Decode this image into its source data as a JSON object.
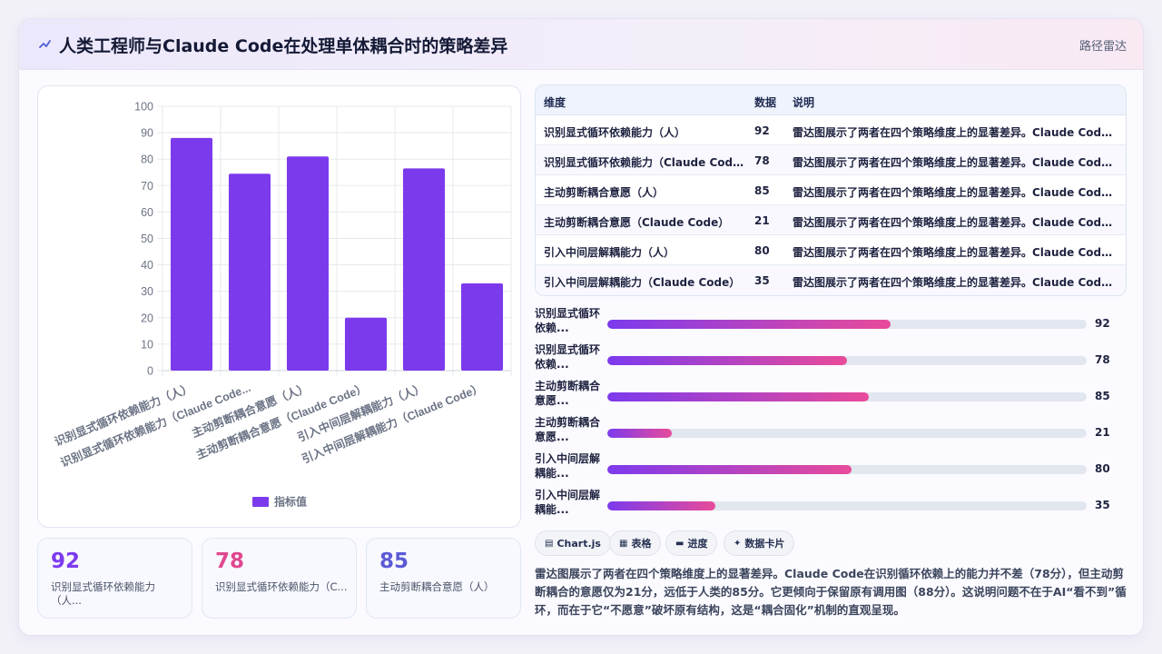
{
  "header": {
    "logo_icon": "wave-icon",
    "title": "人类工程师与Claude Code在处理单体耦合时的策略差异",
    "right_link": "路径雷达"
  },
  "chart_data": {
    "type": "bar",
    "categories": [
      "识别显式循环依赖能力（人）",
      "识别显式循环依赖能力（Claude Code...",
      "主动剪断耦合意愿（人）",
      "主动剪断耦合意愿（Claude Code）",
      "引入中间层解耦能力（人）",
      "引入中间层解耦能力（Claude Code）"
    ],
    "series": [
      {
        "name": "指标值",
        "values": [
          88,
          74.5,
          81,
          20,
          76.5,
          33
        ]
      }
    ],
    "ylim": [
      0,
      100
    ],
    "yticks": [
      0,
      10,
      20,
      30,
      40,
      50,
      60,
      70,
      80,
      90,
      100
    ],
    "grid": true,
    "legend": "bottom",
    "bar_color": "#7c3aed"
  },
  "stats": [
    {
      "value": "92",
      "label": "识别显式循环依赖能力（人...",
      "color": "#7c3aed"
    },
    {
      "value": "78",
      "label": "识别显式循环依赖能力（C...",
      "color": "#e0488f"
    },
    {
      "value": "85",
      "label": "主动剪断耦合意愿（人）",
      "color": "#5b5bd6"
    }
  ],
  "table": {
    "headers": [
      "维度",
      "数据",
      "说明"
    ],
    "rows": [
      {
        "dim": "识别显式循环依赖能力（人）",
        "val": "92",
        "desc": "雷达图展示了两者在四个策略维度上的显著差异。Claude Code在..."
      },
      {
        "dim": "识别显式循环依赖能力（Claude Code...",
        "val": "78",
        "desc": "雷达图展示了两者在四个策略维度上的显著差异。Claude Code在..."
      },
      {
        "dim": "主动剪断耦合意愿（人）",
        "val": "85",
        "desc": "雷达图展示了两者在四个策略维度上的显著差异。Claude Code在..."
      },
      {
        "dim": "主动剪断耦合意愿（Claude Code）",
        "val": "21",
        "desc": "雷达图展示了两者在四个策略维度上的显著差异。Claude Code在..."
      },
      {
        "dim": "引入中间层解耦能力（人）",
        "val": "80",
        "desc": "雷达图展示了两者在四个策略维度上的显著差异。Claude Code在..."
      },
      {
        "dim": "引入中间层解耦能力（Claude Code）",
        "val": "35",
        "desc": "雷达图展示了两者在四个策略维度上的显著差异。Claude Code在..."
      }
    ]
  },
  "progress": [
    {
      "label": "识别显式循环依赖...",
      "value": "92",
      "percent": 59
    },
    {
      "label": "识别显式循环依赖...",
      "value": "78",
      "percent": 50
    },
    {
      "label": "主动剪断耦合意愿...",
      "value": "85",
      "percent": 54.5
    },
    {
      "label": "主动剪断耦合意愿...",
      "value": "21",
      "percent": 13.5
    },
    {
      "label": "引入中间层解耦能...",
      "value": "80",
      "percent": 51
    },
    {
      "label": "引入中间层解耦能...",
      "value": "35",
      "percent": 22.5
    }
  ],
  "chips": [
    {
      "icon": "chart-icon",
      "glyph": "▤",
      "label": "Chart.js"
    },
    {
      "icon": "table-icon",
      "glyph": "▦",
      "label": "表格"
    },
    {
      "icon": "progress-icon",
      "glyph": "▬",
      "label": "进度"
    },
    {
      "icon": "sparkle-icon",
      "glyph": "✦",
      "label": "数据卡片"
    }
  ],
  "summary": "雷达图展示了两者在四个策略维度上的显著差异。Claude Code在识别循环依赖上的能力并不差（78分），但主动剪断耦合的意愿仅为21分，远低于人类的85分。它更倾向于保留原有调用图（88分）。这说明问题不在于AI“看不到”循环，而在于它“不愿意”破坏原有结构，这是“耦合固化”机制的直观呈现。"
}
